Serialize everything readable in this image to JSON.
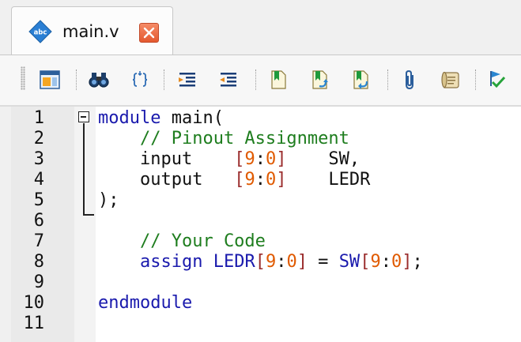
{
  "tab": {
    "title": "main.v",
    "icon": "abc-file-icon",
    "close_icon": "close-icon"
  },
  "toolbar": {
    "buttons": [
      "window-layout-icon",
      "binoculars-find-icon",
      "braces-match-icon",
      "indent-icon",
      "outdent-icon",
      "bookmark-icon",
      "bookmark-next-icon",
      "bookmark-prev-icon",
      "paperclip-icon",
      "scroll-icon",
      "run-flag-icon"
    ]
  },
  "editor": {
    "line_numbers": [
      "1",
      "2",
      "3",
      "4",
      "5",
      "6",
      "7",
      "8",
      "9",
      "10",
      "11"
    ],
    "lines": [
      {
        "tokens": [
          {
            "t": "module",
            "c": "kw"
          },
          {
            "t": " main(",
            "c": "id"
          }
        ]
      },
      {
        "tokens": [
          {
            "t": "    // Pinout Assignment",
            "c": "cm"
          }
        ]
      },
      {
        "tokens": [
          {
            "t": "    input    ",
            "c": "id"
          },
          {
            "t": "[",
            "c": "brk"
          },
          {
            "t": "9",
            "c": "num"
          },
          {
            "t": ":",
            "c": "id"
          },
          {
            "t": "0",
            "c": "num"
          },
          {
            "t": "]",
            "c": "brk"
          },
          {
            "t": "    SW,",
            "c": "id"
          }
        ]
      },
      {
        "tokens": [
          {
            "t": "    output   ",
            "c": "id"
          },
          {
            "t": "[",
            "c": "brk"
          },
          {
            "t": "9",
            "c": "num"
          },
          {
            "t": ":",
            "c": "id"
          },
          {
            "t": "0",
            "c": "num"
          },
          {
            "t": "]",
            "c": "brk"
          },
          {
            "t": "    LEDR",
            "c": "id"
          }
        ]
      },
      {
        "tokens": [
          {
            "t": ");",
            "c": "id"
          }
        ]
      },
      {
        "tokens": [
          {
            "t": "",
            "c": "id"
          }
        ]
      },
      {
        "tokens": [
          {
            "t": "    // Your Code",
            "c": "cm"
          }
        ]
      },
      {
        "tokens": [
          {
            "t": "    assign ",
            "c": "kw"
          },
          {
            "t": "LEDR",
            "c": "kw"
          },
          {
            "t": "[",
            "c": "brk"
          },
          {
            "t": "9",
            "c": "num"
          },
          {
            "t": ":",
            "c": "id"
          },
          {
            "t": "0",
            "c": "num"
          },
          {
            "t": "]",
            "c": "brk"
          },
          {
            "t": " = ",
            "c": "id"
          },
          {
            "t": "SW",
            "c": "kw"
          },
          {
            "t": "[",
            "c": "brk"
          },
          {
            "t": "9",
            "c": "num"
          },
          {
            "t": ":",
            "c": "id"
          },
          {
            "t": "0",
            "c": "num"
          },
          {
            "t": "]",
            "c": "brk"
          },
          {
            "t": ";",
            "c": "id"
          }
        ]
      },
      {
        "tokens": [
          {
            "t": "",
            "c": "id"
          }
        ]
      },
      {
        "tokens": [
          {
            "t": "endmodule",
            "c": "kw"
          }
        ]
      },
      {
        "tokens": [
          {
            "t": "",
            "c": "id"
          }
        ]
      }
    ]
  }
}
